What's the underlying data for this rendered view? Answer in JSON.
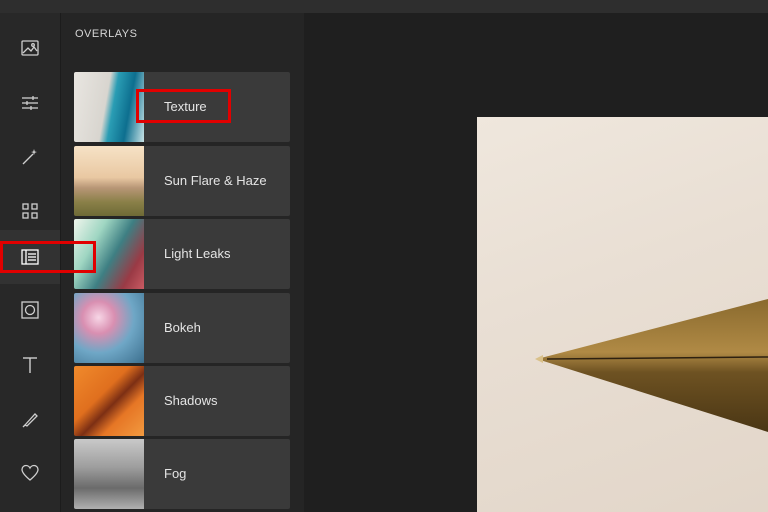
{
  "panel": {
    "title": "OVERLAYS",
    "items": [
      {
        "label": "Texture"
      },
      {
        "label": "Sun Flare & Haze"
      },
      {
        "label": "Light Leaks"
      },
      {
        "label": "Bokeh"
      },
      {
        "label": "Shadows"
      },
      {
        "label": "Fog"
      }
    ]
  },
  "toolrail": {
    "tools": [
      {
        "icon": "image-icon"
      },
      {
        "icon": "sliders-icon"
      },
      {
        "icon": "magic-wand-icon"
      },
      {
        "icon": "grid-icon"
      },
      {
        "icon": "overlays-icon",
        "active": true
      },
      {
        "icon": "frame-icon"
      },
      {
        "icon": "text-icon"
      },
      {
        "icon": "brush-icon"
      },
      {
        "icon": "heart-icon"
      }
    ]
  },
  "colors": {
    "accent_highlight": "#e10000",
    "panel_bg": "#252525",
    "item_bg": "#3a3a3a",
    "rail_bg": "#282828"
  }
}
